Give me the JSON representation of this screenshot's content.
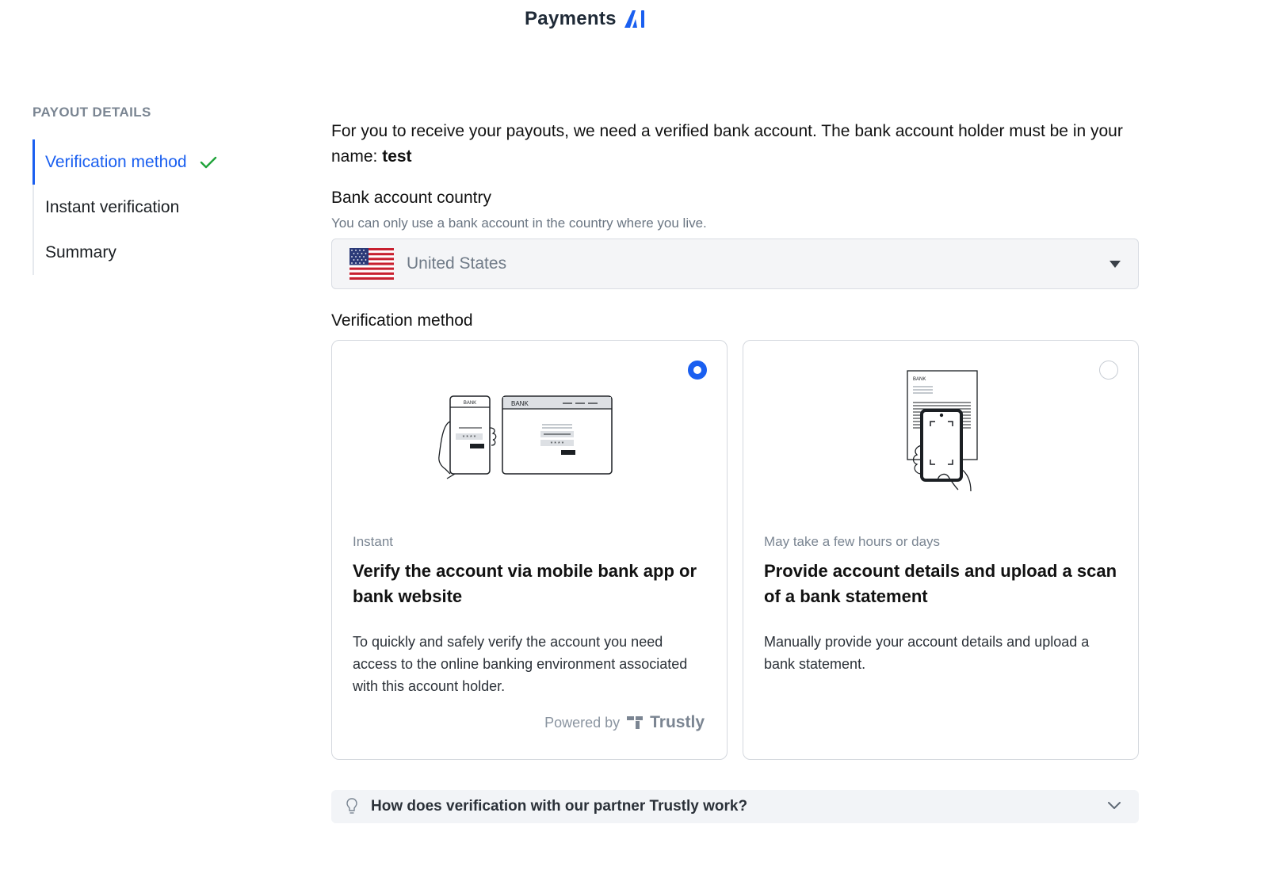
{
  "header": {
    "brand_name": "Payments",
    "brand_mark": "AI",
    "brand_color": "#1a5ff0"
  },
  "sidebar": {
    "heading": "PAYOUT DETAILS",
    "steps": [
      {
        "label": "Verification method",
        "active": true,
        "completed": true,
        "icon": "check-icon"
      },
      {
        "label": "Instant verification",
        "active": false,
        "completed": false
      },
      {
        "label": "Summary",
        "active": false,
        "completed": false
      }
    ]
  },
  "main": {
    "intro_text": "For you to receive your payouts, we need a verified bank account. The bank account holder must be in your name: ",
    "account_name": "test",
    "country": {
      "label": "Bank account country",
      "hint": "You can only use a bank account in the country where you live.",
      "selected_value": "United States",
      "flag_icon": "us-flag-icon"
    },
    "verification": {
      "label": "Verification method",
      "options": [
        {
          "selected": true,
          "tag": "Instant",
          "title": "Verify the account via mobile bank app or bank website",
          "description": "To quickly and safely verify the account you need access to the online banking environment associated with this account holder.",
          "illustration_text_phone": "BANK",
          "illustration_text_browser": "BANK",
          "powered_by_label": "Powered by",
          "powered_by_brand": "Trustly"
        },
        {
          "selected": false,
          "tag": "May take a few hours or days",
          "title": "Provide account details and upload a scan of a bank statement",
          "description": "Manually provide your account details and upload a bank statement.",
          "illustration_text": "BANK"
        }
      ]
    },
    "faq": {
      "question": "How does verification with our partner Trustly work?",
      "icon": "lightbulb-icon"
    }
  },
  "colors": {
    "accent": "#1a5ff0",
    "success": "#1fa33a",
    "muted_text": "#7a8592"
  }
}
